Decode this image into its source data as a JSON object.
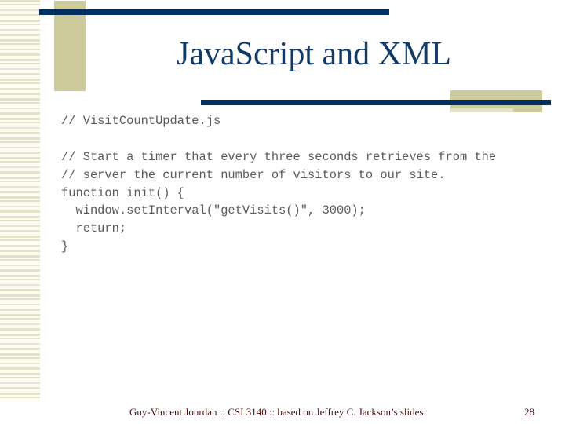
{
  "slide": {
    "title": "JavaScript and XML",
    "code_lines": [
      "// VisitCountUpdate.js",
      "",
      "// Start a timer that every three seconds retrieves from the",
      "// server the current number of visitors to our site.",
      "function init() {",
      "  window.setInterval(\"getVisits()\", 3000);",
      "  return;",
      "}"
    ],
    "footer": "Guy-Vincent Jourdan :: CSI 3140 :: based on Jeffrey C. Jackson’s slides",
    "page_number": "28"
  },
  "colors": {
    "navy": "#003060",
    "olive": "#cdcb9c",
    "title": "#123a66",
    "footer": "#4a1010"
  }
}
